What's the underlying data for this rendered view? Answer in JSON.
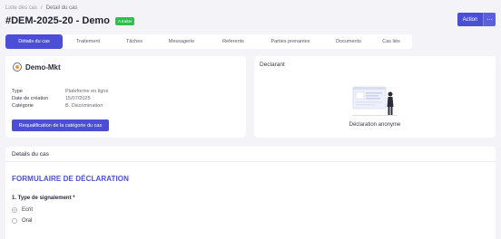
{
  "breadcrumb": {
    "root": "Liste des cas",
    "separator": "/",
    "current": "Detail du cas"
  },
  "header": {
    "title": "#DEM-2025-20 - Demo",
    "status": "A traiter",
    "action_label": "Action",
    "more_label": "⋯"
  },
  "tabs": [
    {
      "label": "Détails du cas",
      "active": true
    },
    {
      "label": "Traitement"
    },
    {
      "label": "Tâches"
    },
    {
      "label": "Messagerie"
    },
    {
      "label": "Referents"
    },
    {
      "label": "Parties prenantes"
    },
    {
      "label": "Documents"
    },
    {
      "label": "Cas liés"
    }
  ],
  "entity": {
    "name": "Demo-Mkt"
  },
  "info": [
    {
      "key": "Type",
      "value": "Plateforme en ligne"
    },
    {
      "key": "Date de création",
      "value": "15/07/2025"
    },
    {
      "key": "Catégorie",
      "value": "B. Discrimination"
    }
  ],
  "requal_button": "Requalification de la catégorie du cas",
  "declarant": {
    "title": "Declarant",
    "caption": "Déclaration anonyme"
  },
  "details": {
    "header": "Details du cas",
    "form_title": "FORMULAIRE DE DÉCLARATION",
    "question": "1. Type de signalement *",
    "options": [
      {
        "label": "Ecrit",
        "checked": true
      },
      {
        "label": "Oral",
        "checked": false
      }
    ]
  },
  "colors": {
    "primary": "#4b4fd6",
    "status": "#2fbf4a",
    "background": "#f4f4f8"
  }
}
